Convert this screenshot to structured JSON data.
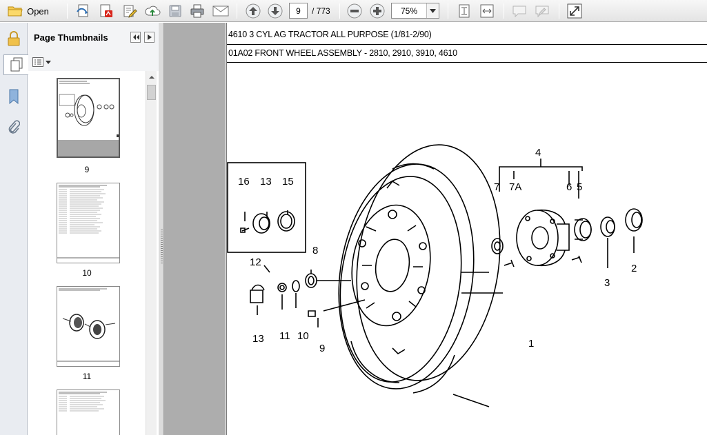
{
  "toolbar": {
    "open_label": "Open",
    "current_page": "9",
    "page_total": "/ 773",
    "zoom": "75%"
  },
  "thumbnails_panel": {
    "title": "Page Thumbnails",
    "thumbnails": [
      {
        "label": "9"
      },
      {
        "label": "10"
      },
      {
        "label": "11"
      }
    ]
  },
  "document": {
    "line1": "4610 3 CYL AG TRACTOR ALL PURPOSE (1/81-2/90)",
    "line2": "01A02 FRONT WHEEL ASSEMBLY - 2810, 2910, 3910, 4610",
    "callouts": {
      "c1": "1",
      "c2": "2",
      "c3": "3",
      "c4": "4",
      "c5": "5",
      "c6": "6",
      "c7": "7",
      "c7a": "7A",
      "c8": "8",
      "c9": "9",
      "c10": "10",
      "c11": "11",
      "c12": "12",
      "c13_inset": "13",
      "c13": "13",
      "c15": "15",
      "c16": "16"
    }
  },
  "colors": {
    "toolbar_bg": "#ececec",
    "panel_bg": "#f3f4f6",
    "workspace_gray": "#adadad"
  }
}
